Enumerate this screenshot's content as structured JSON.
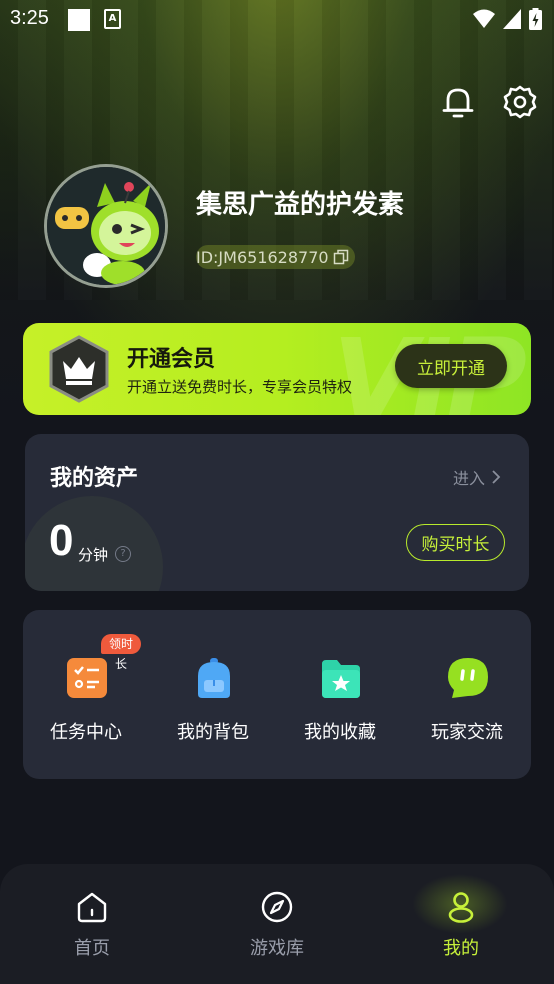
{
  "status_bar": {
    "time": "3:25",
    "a_icon_text": "A"
  },
  "profile": {
    "username": "集思广益的护发素",
    "user_id": "ID:JM651628770"
  },
  "vip": {
    "title": "开通会员",
    "subtitle": "开通立送免费时长，专享会员特权",
    "button": "立即开通",
    "watermark": "VIP"
  },
  "assets": {
    "title": "我的资产",
    "enter": "进入",
    "value": "0",
    "unit": "分钟",
    "help": "?",
    "buy_button": "购买时长"
  },
  "quick": {
    "items": [
      {
        "label": "任务中心",
        "icon": "task-list-icon",
        "badge": "领时长"
      },
      {
        "label": "我的背包",
        "icon": "backpack-icon"
      },
      {
        "label": "我的收藏",
        "icon": "favorite-folder-icon"
      },
      {
        "label": "玩家交流",
        "icon": "chat-bubble-icon"
      }
    ]
  },
  "nav": {
    "items": [
      {
        "label": "首页",
        "icon": "home-icon"
      },
      {
        "label": "游戏库",
        "icon": "compass-icon"
      },
      {
        "label": "我的",
        "icon": "profile-icon",
        "active": true
      }
    ]
  },
  "colors": {
    "accent": "#c6f03a",
    "card": "#272b38",
    "background": "#13151c",
    "badge": "#ef5a3c"
  }
}
